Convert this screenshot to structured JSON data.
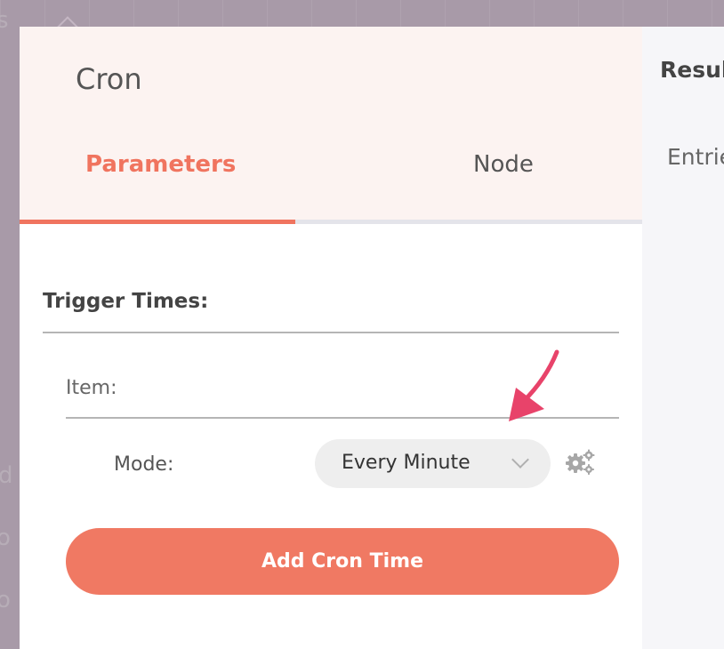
{
  "background": {
    "fragments": [
      "s",
      "d",
      "o",
      "o"
    ]
  },
  "dialog": {
    "title": "Cron",
    "tabs": [
      {
        "label": "Parameters",
        "active": true
      },
      {
        "label": "Node",
        "active": false
      }
    ],
    "parameters": {
      "section_label": "Trigger Times:",
      "item_label": "Item:",
      "mode_label": "Mode:",
      "mode_value": "Every Minute",
      "mode_icon": "chevron-down-icon",
      "settings_icon": "gears-icon",
      "add_button_label": "Add Cron Time"
    }
  },
  "results_panel": {
    "title": "Resul",
    "entries_label": "Entrie"
  },
  "colors": {
    "accent": "#f0745f",
    "button": "#f07963",
    "header_bg": "#fcf3f1",
    "arrow": "#e8436a"
  }
}
